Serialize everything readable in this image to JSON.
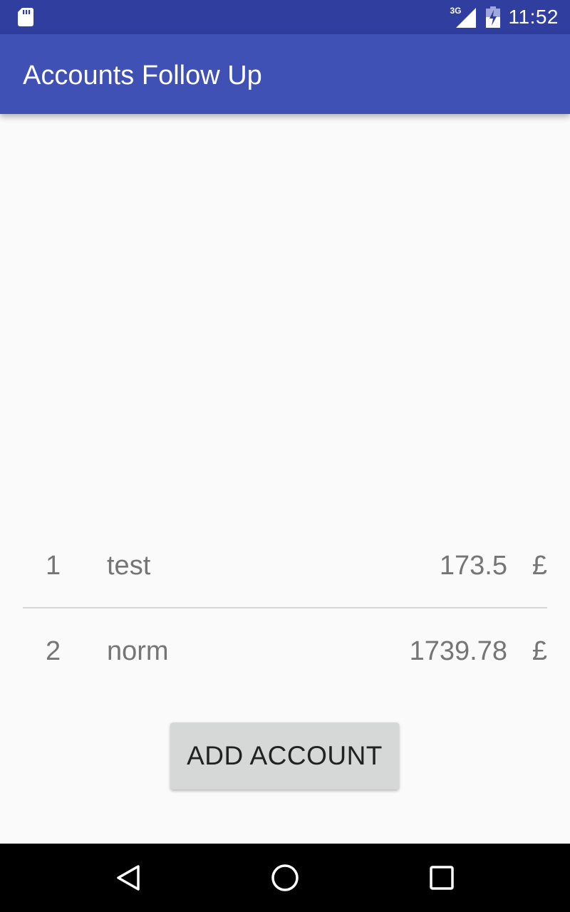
{
  "status_bar": {
    "network_type": "3G",
    "time": "11:52",
    "icons": [
      "sd-card-icon",
      "signal-icon",
      "battery-icon"
    ]
  },
  "app_bar": {
    "title": "Accounts Follow Up",
    "color": "#3f51b5"
  },
  "accounts": {
    "rows": [
      {
        "index": "1",
        "name": "test",
        "amount": "173.5",
        "currency": "£"
      },
      {
        "index": "2",
        "name": "norm",
        "amount": "1739.78",
        "currency": "£"
      }
    ]
  },
  "actions": {
    "add_account_label": "ADD ACCOUNT"
  },
  "navigation": {
    "icons": [
      "back-icon",
      "home-icon",
      "recent-apps-icon"
    ]
  }
}
